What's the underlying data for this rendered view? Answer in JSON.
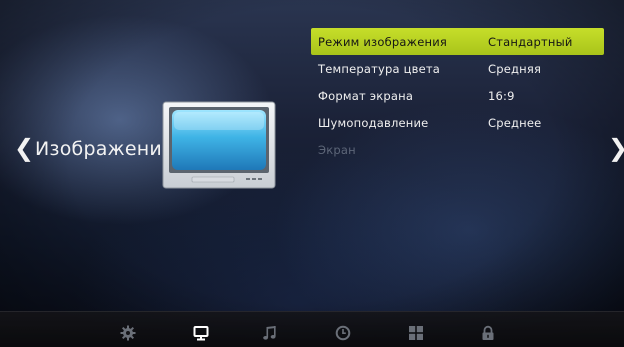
{
  "category": {
    "label": "Изображение",
    "prev_arrow": "❮",
    "next_arrow": "❯",
    "icon": "tv-icon"
  },
  "menu": {
    "items": [
      {
        "label": "Режим изображения",
        "value": "Стандартный",
        "selected": true,
        "enabled": true
      },
      {
        "label": "Температура цвета",
        "value": "Средняя",
        "selected": false,
        "enabled": true
      },
      {
        "label": "Формат экрана",
        "value": "16:9",
        "selected": false,
        "enabled": true
      },
      {
        "label": "Шумоподавление",
        "value": "Среднее",
        "selected": false,
        "enabled": true
      },
      {
        "label": "Экран",
        "value": "",
        "selected": false,
        "enabled": false
      }
    ]
  },
  "bottom_bar": {
    "icons": [
      "gear-icon",
      "monitor-icon",
      "music-note-icon",
      "clock-icon",
      "grid-icon",
      "lock-icon"
    ],
    "active": "monitor-icon"
  },
  "colors": {
    "selection": "#b6d020",
    "text": "#f0f0f0",
    "disabled_text": "#5d6678",
    "active_icon": "#ffffff",
    "inactive_icon": "#6a6f78"
  }
}
